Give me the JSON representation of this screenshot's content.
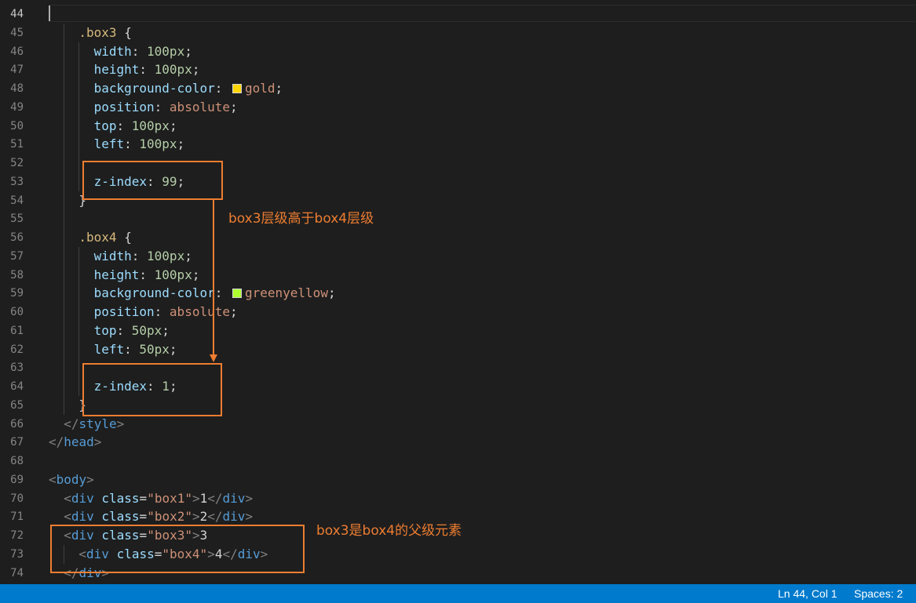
{
  "editor": {
    "active_line": "44",
    "lines": [
      {
        "n": "44",
        "indent": 0,
        "tokens": []
      },
      {
        "n": "45",
        "indent": 2,
        "tokens": [
          {
            "t": ".box3",
            "c": "sel"
          },
          {
            "t": " {",
            "c": "txt"
          }
        ]
      },
      {
        "n": "46",
        "indent": 3,
        "tokens": [
          {
            "t": "width",
            "c": "prop"
          },
          {
            "t": ": ",
            "c": "txt"
          },
          {
            "t": "100px",
            "c": "num"
          },
          {
            "t": ";",
            "c": "txt"
          }
        ]
      },
      {
        "n": "47",
        "indent": 3,
        "tokens": [
          {
            "t": "height",
            "c": "prop"
          },
          {
            "t": ": ",
            "c": "txt"
          },
          {
            "t": "100px",
            "c": "num"
          },
          {
            "t": ";",
            "c": "txt"
          }
        ]
      },
      {
        "n": "48",
        "indent": 3,
        "tokens": [
          {
            "t": "background-color",
            "c": "prop"
          },
          {
            "t": ": ",
            "c": "txt"
          },
          {
            "swatch": "#ffd700"
          },
          {
            "t": "gold",
            "c": "val"
          },
          {
            "t": ";",
            "c": "txt"
          }
        ]
      },
      {
        "n": "49",
        "indent": 3,
        "tokens": [
          {
            "t": "position",
            "c": "prop"
          },
          {
            "t": ": ",
            "c": "txt"
          },
          {
            "t": "absolute",
            "c": "val"
          },
          {
            "t": ";",
            "c": "txt"
          }
        ]
      },
      {
        "n": "50",
        "indent": 3,
        "tokens": [
          {
            "t": "top",
            "c": "prop"
          },
          {
            "t": ": ",
            "c": "txt"
          },
          {
            "t": "100px",
            "c": "num"
          },
          {
            "t": ";",
            "c": "txt"
          }
        ]
      },
      {
        "n": "51",
        "indent": 3,
        "tokens": [
          {
            "t": "left",
            "c": "prop"
          },
          {
            "t": ": ",
            "c": "txt"
          },
          {
            "t": "100px",
            "c": "num"
          },
          {
            "t": ";",
            "c": "txt"
          }
        ]
      },
      {
        "n": "52",
        "indent": 3,
        "tokens": []
      },
      {
        "n": "53",
        "indent": 3,
        "tokens": [
          {
            "t": "z-index",
            "c": "prop"
          },
          {
            "t": ": ",
            "c": "txt"
          },
          {
            "t": "99",
            "c": "num"
          },
          {
            "t": ";",
            "c": "txt"
          }
        ]
      },
      {
        "n": "54",
        "indent": 2,
        "tokens": [
          {
            "t": "}",
            "c": "txt"
          }
        ]
      },
      {
        "n": "55",
        "indent": 2,
        "tokens": []
      },
      {
        "n": "56",
        "indent": 2,
        "tokens": [
          {
            "t": ".box4",
            "c": "sel"
          },
          {
            "t": " {",
            "c": "txt"
          }
        ]
      },
      {
        "n": "57",
        "indent": 3,
        "tokens": [
          {
            "t": "width",
            "c": "prop"
          },
          {
            "t": ": ",
            "c": "txt"
          },
          {
            "t": "100px",
            "c": "num"
          },
          {
            "t": ";",
            "c": "txt"
          }
        ]
      },
      {
        "n": "58",
        "indent": 3,
        "tokens": [
          {
            "t": "height",
            "c": "prop"
          },
          {
            "t": ": ",
            "c": "txt"
          },
          {
            "t": "100px",
            "c": "num"
          },
          {
            "t": ";",
            "c": "txt"
          }
        ]
      },
      {
        "n": "59",
        "indent": 3,
        "tokens": [
          {
            "t": "background-color",
            "c": "prop"
          },
          {
            "t": ": ",
            "c": "txt"
          },
          {
            "swatch": "#adff2f"
          },
          {
            "t": "greenyellow",
            "c": "val"
          },
          {
            "t": ";",
            "c": "txt"
          }
        ]
      },
      {
        "n": "60",
        "indent": 3,
        "tokens": [
          {
            "t": "position",
            "c": "prop"
          },
          {
            "t": ": ",
            "c": "txt"
          },
          {
            "t": "absolute",
            "c": "val"
          },
          {
            "t": ";",
            "c": "txt"
          }
        ]
      },
      {
        "n": "61",
        "indent": 3,
        "tokens": [
          {
            "t": "top",
            "c": "prop"
          },
          {
            "t": ": ",
            "c": "txt"
          },
          {
            "t": "50px",
            "c": "num"
          },
          {
            "t": ";",
            "c": "txt"
          }
        ]
      },
      {
        "n": "62",
        "indent": 3,
        "tokens": [
          {
            "t": "left",
            "c": "prop"
          },
          {
            "t": ": ",
            "c": "txt"
          },
          {
            "t": "50px",
            "c": "num"
          },
          {
            "t": ";",
            "c": "txt"
          }
        ]
      },
      {
        "n": "63",
        "indent": 3,
        "tokens": []
      },
      {
        "n": "64",
        "indent": 3,
        "tokens": [
          {
            "t": "z-index",
            "c": "prop"
          },
          {
            "t": ": ",
            "c": "txt"
          },
          {
            "t": "1",
            "c": "num"
          },
          {
            "t": ";",
            "c": "txt"
          }
        ]
      },
      {
        "n": "65",
        "indent": 2,
        "tokens": [
          {
            "t": "}",
            "c": "txt"
          }
        ]
      },
      {
        "n": "66",
        "indent": 1,
        "tokens": [
          {
            "t": "</",
            "c": "punc"
          },
          {
            "t": "style",
            "c": "tag"
          },
          {
            "t": ">",
            "c": "punc"
          }
        ]
      },
      {
        "n": "67",
        "indent": 0,
        "tokens": [
          {
            "t": "</",
            "c": "punc"
          },
          {
            "t": "head",
            "c": "tag"
          },
          {
            "t": ">",
            "c": "punc"
          }
        ]
      },
      {
        "n": "68",
        "indent": 0,
        "tokens": []
      },
      {
        "n": "69",
        "indent": 0,
        "tokens": [
          {
            "t": "<",
            "c": "punc"
          },
          {
            "t": "body",
            "c": "tag"
          },
          {
            "t": ">",
            "c": "punc"
          }
        ]
      },
      {
        "n": "70",
        "indent": 1,
        "tokens": [
          {
            "t": "<",
            "c": "punc"
          },
          {
            "t": "div",
            "c": "tag"
          },
          {
            "t": " ",
            "c": "txt"
          },
          {
            "t": "class",
            "c": "attr"
          },
          {
            "t": "=",
            "c": "txt"
          },
          {
            "t": "\"box1\"",
            "c": "str"
          },
          {
            "t": ">",
            "c": "punc"
          },
          {
            "t": "1",
            "c": "txt"
          },
          {
            "t": "</",
            "c": "punc"
          },
          {
            "t": "div",
            "c": "tag"
          },
          {
            "t": ">",
            "c": "punc"
          }
        ]
      },
      {
        "n": "71",
        "indent": 1,
        "tokens": [
          {
            "t": "<",
            "c": "punc"
          },
          {
            "t": "div",
            "c": "tag"
          },
          {
            "t": " ",
            "c": "txt"
          },
          {
            "t": "class",
            "c": "attr"
          },
          {
            "t": "=",
            "c": "txt"
          },
          {
            "t": "\"box2\"",
            "c": "str"
          },
          {
            "t": ">",
            "c": "punc"
          },
          {
            "t": "2",
            "c": "txt"
          },
          {
            "t": "</",
            "c": "punc"
          },
          {
            "t": "div",
            "c": "tag"
          },
          {
            "t": ">",
            "c": "punc"
          }
        ]
      },
      {
        "n": "72",
        "indent": 1,
        "tokens": [
          {
            "t": "<",
            "c": "punc"
          },
          {
            "t": "div",
            "c": "tag"
          },
          {
            "t": " ",
            "c": "txt"
          },
          {
            "t": "class",
            "c": "attr"
          },
          {
            "t": "=",
            "c": "txt"
          },
          {
            "t": "\"box3\"",
            "c": "str"
          },
          {
            "t": ">",
            "c": "punc"
          },
          {
            "t": "3",
            "c": "txt"
          }
        ]
      },
      {
        "n": "73",
        "indent": 2,
        "tokens": [
          {
            "t": "<",
            "c": "punc"
          },
          {
            "t": "div",
            "c": "tag"
          },
          {
            "t": " ",
            "c": "txt"
          },
          {
            "t": "class",
            "c": "attr"
          },
          {
            "t": "=",
            "c": "txt"
          },
          {
            "t": "\"box4\"",
            "c": "str"
          },
          {
            "t": ">",
            "c": "punc"
          },
          {
            "t": "4",
            "c": "txt"
          },
          {
            "t": "</",
            "c": "punc"
          },
          {
            "t": "div",
            "c": "tag"
          },
          {
            "t": ">",
            "c": "punc"
          }
        ]
      },
      {
        "n": "74",
        "indent": 1,
        "tokens": [
          {
            "t": "</",
            "c": "punc"
          },
          {
            "t": "div",
            "c": "tag"
          },
          {
            "t": ">",
            "c": "punc"
          }
        ]
      }
    ]
  },
  "annotations": {
    "note_zindex": "box3层级高于box4层级",
    "note_parent": "box3是box4的父级元素",
    "color": "#ed7d31"
  },
  "statusbar": {
    "position": "Ln 44, Col 1",
    "spaces": "Spaces: 2",
    "background": "#007acc"
  }
}
